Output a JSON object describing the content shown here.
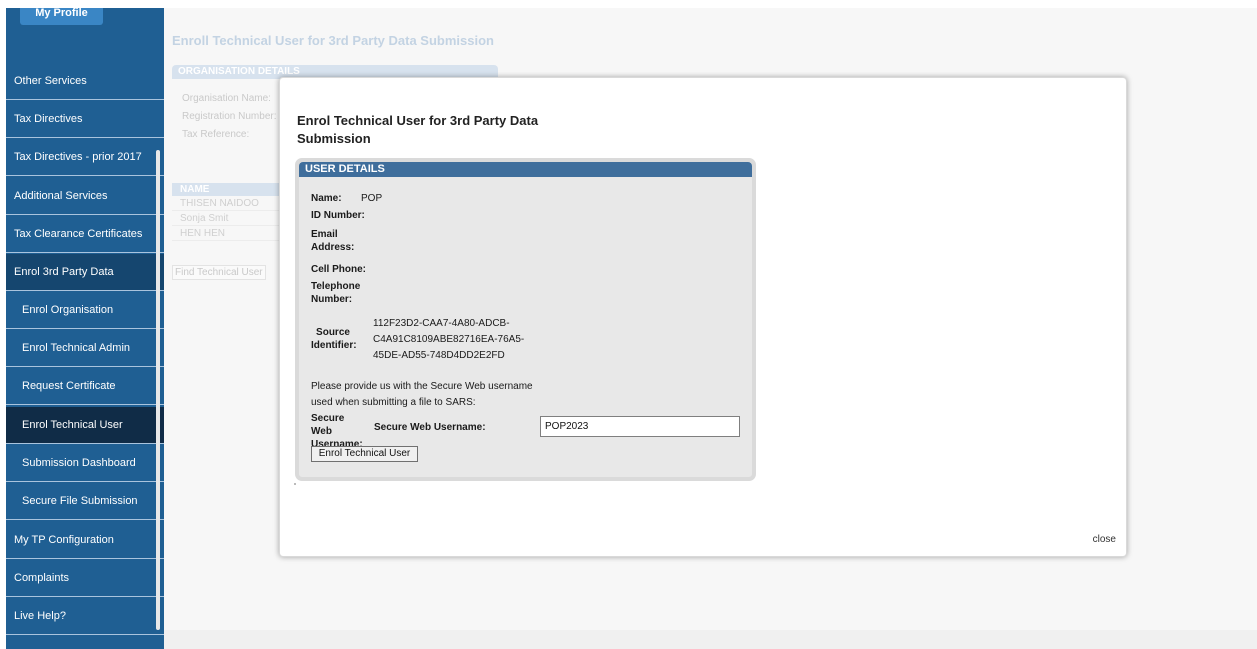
{
  "sidebar": {
    "my_profile": "My Profile",
    "items": [
      {
        "label": "Other Services"
      },
      {
        "label": "Tax Directives"
      },
      {
        "label": "Tax Directives - prior 2017"
      },
      {
        "label": "Additional Services"
      },
      {
        "label": "Tax Clearance Certificates"
      },
      {
        "label": "Enrol 3rd Party Data"
      },
      {
        "label": "Enrol Organisation"
      },
      {
        "label": "Enrol Technical Admin"
      },
      {
        "label": "Request Certificate"
      },
      {
        "label": "Enrol Technical User"
      },
      {
        "label": "Submission Dashboard"
      },
      {
        "label": "Secure File Submission"
      },
      {
        "label": "My TP Configuration"
      },
      {
        "label": "Complaints"
      },
      {
        "label": "Live Help?"
      }
    ]
  },
  "background": {
    "page_title": "Enroll Technical User for 3rd Party Data Submission",
    "org_header": "ORGANISATION DETAILS",
    "org_labels": [
      "Organisation Name:",
      "Registration Number:",
      "Tax Reference:"
    ],
    "table_header": "NAME",
    "table_rows": [
      "THISEN NAIDOO",
      "Sonja Smit",
      "HEN HEN"
    ],
    "find_button": "Find Technical User"
  },
  "modal": {
    "title": "Enrol Technical User for 3rd Party Data Submission",
    "close": "close",
    "panel_header": "USER DETAILS",
    "fields": {
      "name_label": "Name:",
      "name_value": "POP",
      "id_label": "ID Number:",
      "email_label": "Email Address:",
      "cell_label": "Cell Phone:",
      "tel_label": "Telephone Number:",
      "source_label": "Source Identifier:",
      "source_value": "112F23D2-CAA7-4A80-ADCB-C4A91C8109ABE82716EA-76A5-45DE-AD55-748D4DD2E2FD"
    },
    "note": "Please provide us with the Secure Web username used when submitting a file to SARS:",
    "sw_outer_label": "Secure Web Username:",
    "sw_inner_label": "Secure Web Username:",
    "sw_value": "POP2023",
    "enrol_button": "Enrol Technical User"
  }
}
